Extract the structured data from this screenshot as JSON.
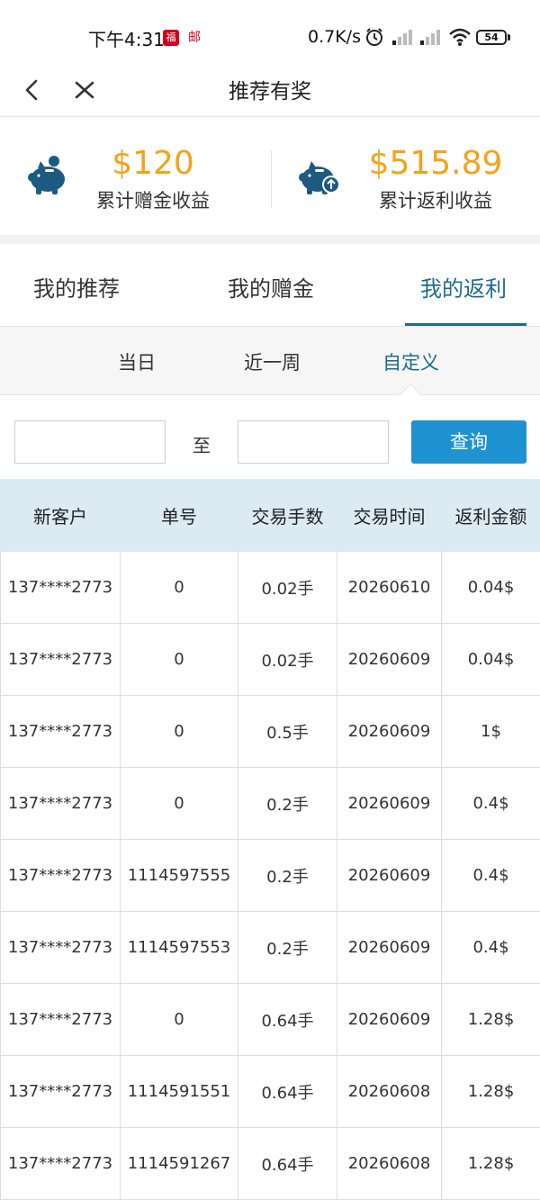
{
  "status_bar": {
    "time": "下午4:31",
    "app_icon_1": "福",
    "app_icon_2": "邮",
    "net_speed": "0.7K/s",
    "battery": "54",
    "icons": [
      "alarm-icon",
      "signal-icon",
      "signal-icon",
      "wifi-icon"
    ]
  },
  "header": {
    "title": "推荐有奖",
    "back_icon": "chevron-left-icon",
    "close_icon": "close-icon"
  },
  "summary": {
    "gift": {
      "amount": "$120",
      "label": "累计赠金收益"
    },
    "rebate": {
      "amount": "$515.89",
      "label": "累计返利收益"
    },
    "accent_color": "#f4a21b",
    "icon_color": "#1d5a80"
  },
  "tabs": [
    {
      "label": "我的推荐",
      "active": false
    },
    {
      "label": "我的赠金",
      "active": false
    },
    {
      "label": "我的返利",
      "active": true
    }
  ],
  "periods": [
    {
      "label": "当日",
      "active": false
    },
    {
      "label": "近一周",
      "active": false
    },
    {
      "label": "自定义",
      "active": true
    }
  ],
  "date_range": {
    "from_value": "",
    "separator": "至",
    "to_value": "",
    "query_label": "查询"
  },
  "table": {
    "headers": [
      "新客户",
      "单号",
      "交易手数",
      "交易时间",
      "返利金额"
    ],
    "rows": [
      [
        "137****2773",
        "0",
        "0.02手",
        "20260610",
        "0.04$"
      ],
      [
        "137****2773",
        "0",
        "0.02手",
        "20260609",
        "0.04$"
      ],
      [
        "137****2773",
        "0",
        "0.5手",
        "20260609",
        "1$"
      ],
      [
        "137****2773",
        "0",
        "0.2手",
        "20260609",
        "0.4$"
      ],
      [
        "137****2773",
        "1114597555",
        "0.2手",
        "20260609",
        "0.4$"
      ],
      [
        "137****2773",
        "1114597553",
        "0.2手",
        "20260609",
        "0.4$"
      ],
      [
        "137****2773",
        "0",
        "0.64手",
        "20260609",
        "1.28$"
      ],
      [
        "137****2773",
        "1114591551",
        "0.64手",
        "20260608",
        "1.28$"
      ],
      [
        "137****2773",
        "1114591267",
        "0.64手",
        "20260608",
        "1.28$"
      ]
    ]
  },
  "colors": {
    "active": "#1d6b8e",
    "button": "#1f92d2",
    "table_header_bg": "#dceaf3"
  }
}
